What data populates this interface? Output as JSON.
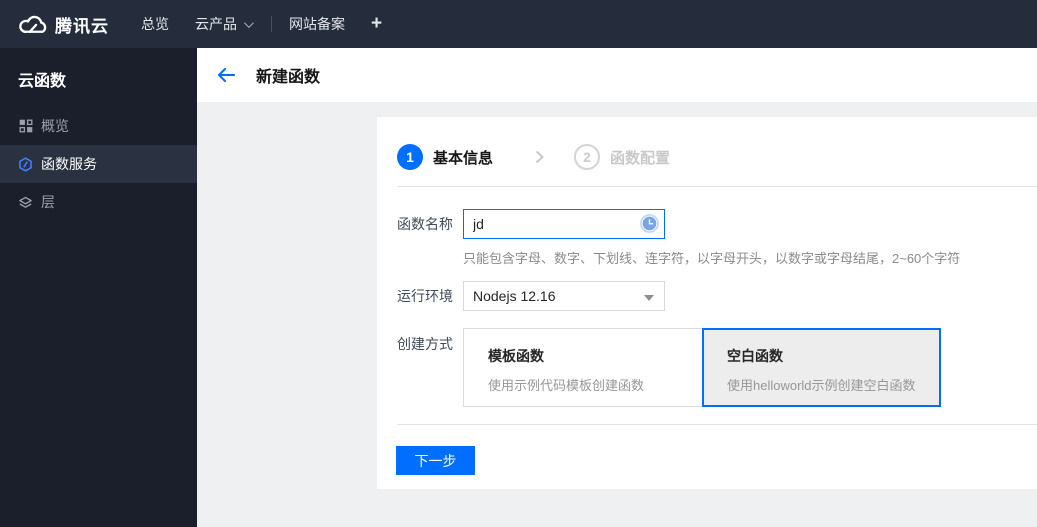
{
  "topnav": {
    "brand": "腾讯云",
    "overview": "总览",
    "products": "云产品",
    "beian": "网站备案",
    "plus": "+"
  },
  "sidebar": {
    "title": "云函数",
    "items": [
      {
        "label": "概览",
        "icon": "grid-icon",
        "active": false
      },
      {
        "label": "函数服务",
        "icon": "scf-hexagon-icon",
        "active": true
      },
      {
        "label": "层",
        "icon": "layers-icon",
        "active": false
      }
    ]
  },
  "header": {
    "title": "新建函数"
  },
  "steps": [
    {
      "number": "1",
      "label": "基本信息",
      "state": "current"
    },
    {
      "number": "2",
      "label": "函数配置",
      "state": "upcoming"
    }
  ],
  "form": {
    "name": {
      "label": "函数名称",
      "value": "jd",
      "help": "只能包含字母、数字、下划线、连字符，以字母开头，以数字或字母结尾，2~60个字符",
      "icon": "clock-ime-icon"
    },
    "runtime": {
      "label": "运行环境",
      "value": "Nodejs 12.16"
    },
    "method": {
      "label": "创建方式",
      "options": [
        {
          "title": "模板函数",
          "desc": "使用示例代码模板创建函数",
          "selected": false
        },
        {
          "title": "空白函数",
          "desc": "使用helloworld示例创建空白函数",
          "selected": true
        }
      ]
    }
  },
  "actions": {
    "next": "下一步"
  },
  "colors": {
    "accent": "#006eff",
    "topnav_bg": "#252d3d",
    "sidebar_bg": "#1a1f2b",
    "content_bg": "#eff0f2"
  }
}
